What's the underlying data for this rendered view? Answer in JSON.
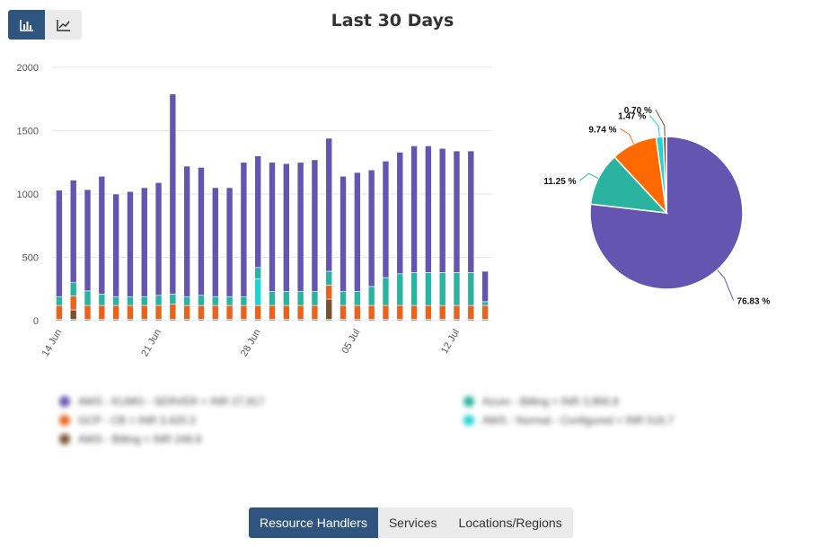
{
  "view_toggle": {
    "bar_icon": "bar-chart-icon",
    "line_icon": "line-chart-icon"
  },
  "chart_data": [
    {
      "type": "bar",
      "stacked": true,
      "title": "Last 30 Days",
      "ylim": [
        0,
        2000
      ],
      "yticks": [
        "0",
        "500",
        "1000",
        "1500",
        "2000"
      ],
      "xtick_labels": [
        "14 Jun",
        "21 Jun",
        "28 Jun",
        "05 Jul",
        "12 Jul"
      ],
      "xtick_indices": [
        0,
        7,
        14,
        21,
        28
      ],
      "grid": true,
      "categories": [
        "14 Jun",
        "15 Jun",
        "16 Jun",
        "17 Jun",
        "18 Jun",
        "19 Jun",
        "20 Jun",
        "21 Jun",
        "22 Jun",
        "23 Jun",
        "24 Jun",
        "25 Jun",
        "26 Jun",
        "27 Jun",
        "28 Jun",
        "29 Jun",
        "30 Jun",
        "01 Jul",
        "02 Jul",
        "03 Jul",
        "04 Jul",
        "05 Jul",
        "06 Jul",
        "07 Jul",
        "08 Jul",
        "09 Jul",
        "10 Jul",
        "11 Jul",
        "12 Jul",
        "13 Jul",
        "14 Jul"
      ],
      "series": [
        {
          "color": "#6b8cb8",
          "values": [
            10,
            10,
            10,
            10,
            10,
            10,
            10,
            10,
            10,
            10,
            10,
            10,
            10,
            10,
            10,
            10,
            10,
            10,
            10,
            10,
            10,
            10,
            10,
            10,
            10,
            10,
            10,
            10,
            10,
            10,
            10
          ]
        },
        {
          "color": "#7a5230",
          "values": [
            0,
            75,
            0,
            0,
            0,
            0,
            0,
            0,
            0,
            0,
            0,
            0,
            0,
            0,
            0,
            0,
            0,
            0,
            0,
            160,
            0,
            0,
            0,
            0,
            0,
            0,
            0,
            0,
            0,
            0,
            0
          ]
        },
        {
          "color": "#e8641c",
          "values": [
            110,
            110,
            110,
            110,
            110,
            110,
            110,
            110,
            120,
            110,
            110,
            110,
            110,
            110,
            110,
            110,
            110,
            110,
            110,
            110,
            110,
            110,
            110,
            110,
            110,
            110,
            110,
            110,
            110,
            110,
            110
          ]
        },
        {
          "color": "#22d3d3",
          "values": [
            0,
            0,
            0,
            0,
            0,
            0,
            0,
            0,
            0,
            0,
            0,
            0,
            0,
            0,
            210,
            0,
            0,
            0,
            0,
            0,
            0,
            0,
            0,
            0,
            0,
            0,
            0,
            0,
            0,
            0,
            0
          ]
        },
        {
          "color": "#2ab3a0",
          "values": [
            70,
            105,
            115,
            90,
            70,
            70,
            70,
            80,
            80,
            70,
            80,
            70,
            70,
            70,
            90,
            110,
            110,
            110,
            110,
            110,
            110,
            110,
            150,
            220,
            250,
            260,
            260,
            260,
            260,
            260,
            30
          ]
        },
        {
          "color": "#6455b0",
          "values": [
            840,
            810,
            800,
            930,
            810,
            830,
            860,
            890,
            1580,
            1030,
            1010,
            860,
            860,
            1060,
            880,
            1020,
            1010,
            1020,
            1040,
            1050,
            910,
            940,
            920,
            920,
            960,
            1000,
            1000,
            980,
            960,
            960,
            240
          ]
        }
      ]
    },
    {
      "type": "pie",
      "slices": [
        {
          "label": "76.83 %",
          "value": 76.83,
          "color": "#6455b0"
        },
        {
          "label": "11.25 %",
          "value": 11.25,
          "color": "#2ab3a0"
        },
        {
          "label": "9.74 %",
          "value": 9.74,
          "color": "#ff6a00"
        },
        {
          "label": "1.47 %",
          "value": 1.47,
          "color": "#22d3d3"
        },
        {
          "label": "0.70 %",
          "value": 0.7,
          "color": "#7a5230"
        }
      ]
    }
  ],
  "legend": [
    {
      "text": "AWS - KUMO - SERVER = INR 27,917",
      "color": "#6455b0"
    },
    {
      "text": "GCP - CB = INR 3,420.3",
      "color": "#e8641c"
    },
    {
      "text": "AWS - Billing = INR 248.8",
      "color": "#7a5230"
    },
    {
      "text": "Azure - Billing = INR 3,956.8",
      "color": "#2ab3a0"
    },
    {
      "text": "AWS - Normal - Configured = INR 516.7",
      "color": "#22d3d3"
    }
  ],
  "tabs": [
    {
      "label": "Resource Handlers",
      "active": true
    },
    {
      "label": "Services",
      "active": false
    },
    {
      "label": "Locations/Regions",
      "active": false
    }
  ]
}
